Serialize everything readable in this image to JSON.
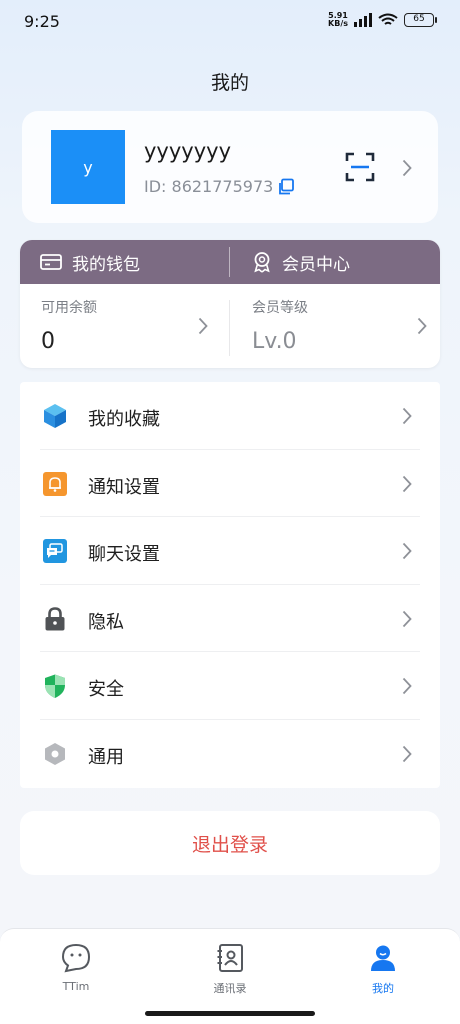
{
  "status_bar": {
    "time": "9:25",
    "net_speed_value": "5.91",
    "net_speed_unit": "KB/s",
    "battery": "65"
  },
  "header": {
    "title": "我的"
  },
  "profile": {
    "avatar_letter": "y",
    "username": "yyyyyyy",
    "id_text": "ID: 8621775973",
    "avatar_color": "#1b8ff7"
  },
  "wallet": {
    "header_color": "#7c6b83",
    "tabs": [
      {
        "label": "我的钱包",
        "icon": "wallet-icon"
      },
      {
        "label": "会员中心",
        "icon": "award-icon"
      }
    ],
    "balance_label": "可用余额",
    "balance_value": "0",
    "level_label": "会员等级",
    "level_value": "Lv.0"
  },
  "menu": {
    "items": [
      {
        "label": "我的收藏",
        "icon": "cube-icon"
      },
      {
        "label": "通知设置",
        "icon": "bell-icon"
      },
      {
        "label": "聊天设置",
        "icon": "chat-icon"
      },
      {
        "label": "隐私",
        "icon": "lock-icon"
      },
      {
        "label": "安全",
        "icon": "shield-icon"
      },
      {
        "label": "通用",
        "icon": "hexagon-icon"
      }
    ]
  },
  "logout": {
    "label": "退出登录",
    "color": "#e0504a"
  },
  "bottom_nav": {
    "items": [
      {
        "label": "TTim",
        "icon": "chat-bubble-icon"
      },
      {
        "label": "通讯录",
        "icon": "contacts-icon"
      },
      {
        "label": "我的",
        "icon": "person-icon",
        "active": true
      }
    ],
    "active_color": "#1677f0"
  }
}
